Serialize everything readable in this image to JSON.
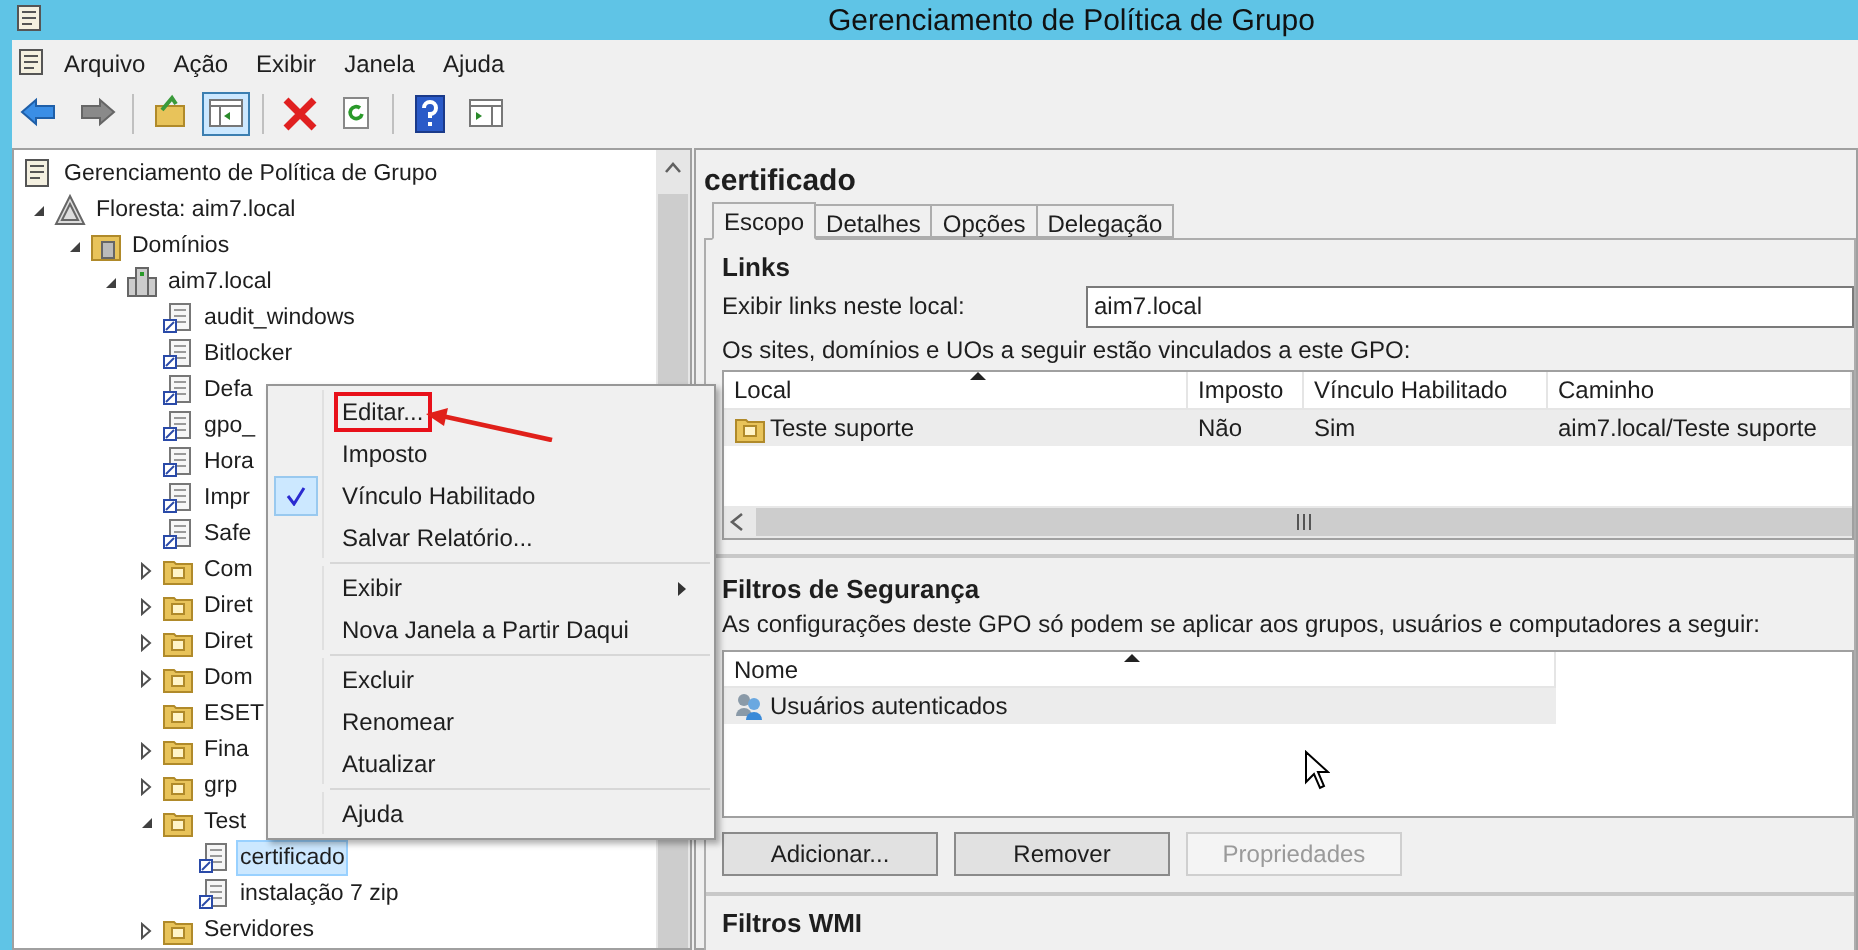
{
  "window": {
    "title": "Gerenciamento de Política de Grupo"
  },
  "menu_bar": [
    "Arquivo",
    "Ação",
    "Exibir",
    "Janela",
    "Ajuda"
  ],
  "toolbar": [
    [
      {
        "kind": "back",
        "pressed": false
      },
      {
        "kind": "forward",
        "pressed": false
      }
    ],
    [
      {
        "kind": "up",
        "pressed": false
      },
      {
        "kind": "tree",
        "pressed": true
      }
    ],
    [
      {
        "kind": "delete",
        "pressed": false
      },
      {
        "kind": "refresh",
        "pressed": false
      }
    ],
    [
      {
        "kind": "help",
        "pressed": false
      },
      {
        "kind": "pane",
        "pressed": false
      }
    ]
  ],
  "tree": [
    {
      "label": "Gerenciamento de Política de Grupo",
      "kind": "root",
      "selected": false,
      "children": [
        {
          "label": "Floresta: aim7.local",
          "kind": "forest",
          "expanded": true,
          "selected": false,
          "children": [
            {
              "label": "Domínios",
              "kind": "domains",
              "expanded": true,
              "selected": false,
              "children": [
                {
                  "label": "aim7.local",
                  "kind": "domain",
                  "expanded": true,
                  "selected": false,
                  "children": [
                    {
                      "label": "audit_windows",
                      "kind": "gpo",
                      "selected": false
                    },
                    {
                      "label": "Bitlocker",
                      "kind": "gpo",
                      "selected": false
                    },
                    {
                      "label": "Defa",
                      "kind": "gpo",
                      "selected": false
                    },
                    {
                      "label": "gpo_",
                      "kind": "gpo",
                      "selected": false
                    },
                    {
                      "label": "Hora",
                      "kind": "gpo",
                      "selected": false
                    },
                    {
                      "label": "Impr",
                      "kind": "gpo",
                      "selected": false
                    },
                    {
                      "label": "Safe",
                      "kind": "gpo",
                      "selected": false
                    },
                    {
                      "label": "Com",
                      "kind": "ou",
                      "expanded": false,
                      "selected": false
                    },
                    {
                      "label": "Diret",
                      "kind": "ou",
                      "expanded": false,
                      "selected": false
                    },
                    {
                      "label": "Diret",
                      "kind": "ou",
                      "expanded": false,
                      "selected": false
                    },
                    {
                      "label": "Dom",
                      "kind": "ou",
                      "expanded": false,
                      "selected": false
                    },
                    {
                      "label": "ESET",
                      "kind": "ou",
                      "selected": false
                    },
                    {
                      "label": "Fina",
                      "kind": "ou",
                      "expanded": false,
                      "selected": false
                    },
                    {
                      "label": "grp",
                      "kind": "ou",
                      "expanded": false,
                      "selected": false
                    },
                    {
                      "label": "Test",
                      "kind": "ou",
                      "expanded": true,
                      "selected": false,
                      "children": [
                        {
                          "label": "certificado",
                          "kind": "gpo",
                          "selected": true
                        },
                        {
                          "label": "instalação 7 zip",
                          "kind": "gpo",
                          "selected": false
                        }
                      ]
                    },
                    {
                      "label": "Servidores",
                      "kind": "ou",
                      "expanded": false,
                      "selected": false
                    }
                  ]
                }
              ]
            }
          ]
        }
      ]
    }
  ],
  "context_menu": [
    {
      "kind": "item",
      "label": "Editar...",
      "checked": false,
      "highlighted": true
    },
    {
      "kind": "item",
      "label": "Imposto",
      "checked": false,
      "highlighted": false
    },
    {
      "kind": "item",
      "label": "Vínculo Habilitado",
      "checked": true,
      "highlighted": false
    },
    {
      "kind": "item",
      "label": "Salvar Relatório...",
      "checked": false,
      "highlighted": false
    },
    {
      "kind": "separator"
    },
    {
      "kind": "submenu",
      "label": "Exibir",
      "checked": false,
      "highlighted": false
    },
    {
      "kind": "item",
      "label": "Nova Janela a Partir Daqui",
      "checked": false,
      "highlighted": false
    },
    {
      "kind": "separator"
    },
    {
      "kind": "item",
      "label": "Excluir",
      "checked": false,
      "highlighted": false
    },
    {
      "kind": "item",
      "label": "Renomear",
      "checked": false,
      "highlighted": false
    },
    {
      "kind": "item",
      "label": "Atualizar",
      "checked": false,
      "highlighted": false
    },
    {
      "kind": "separator"
    },
    {
      "kind": "item",
      "label": "Ajuda",
      "checked": false,
      "highlighted": false
    }
  ],
  "details": {
    "title": "certificado",
    "tabs": [
      {
        "label": "Escopo",
        "selected": true
      },
      {
        "label": "Detalhes",
        "selected": false
      },
      {
        "label": "Opções",
        "selected": false
      },
      {
        "label": "Delegação",
        "selected": false
      }
    ],
    "links": {
      "heading": "Links",
      "location_label": "Exibir links neste local:",
      "location_value": "aim7.local",
      "description": "Os sites, domínios e UOs a seguir estão vinculados a este GPO:",
      "columns": [
        "Local",
        "Imposto",
        "Vínculo Habilitado",
        "Caminho"
      ],
      "rows": [
        [
          "Teste suporte",
          "Não",
          "Sim",
          "aim7.local/Teste suporte"
        ]
      ]
    },
    "security": {
      "heading": "Filtros de Segurança",
      "description": "As configurações deste GPO só podem se aplicar aos grupos, usuários e computadores a seguir:",
      "columns": [
        "Nome"
      ],
      "rows": [
        "Usuários autenticados"
      ],
      "buttons": [
        {
          "label": "Adicionar...",
          "disabled": false
        },
        {
          "label": "Remover",
          "disabled": false
        },
        {
          "label": "Propriedades",
          "disabled": true
        }
      ]
    },
    "wmi": {
      "heading": "Filtros WMI"
    }
  }
}
